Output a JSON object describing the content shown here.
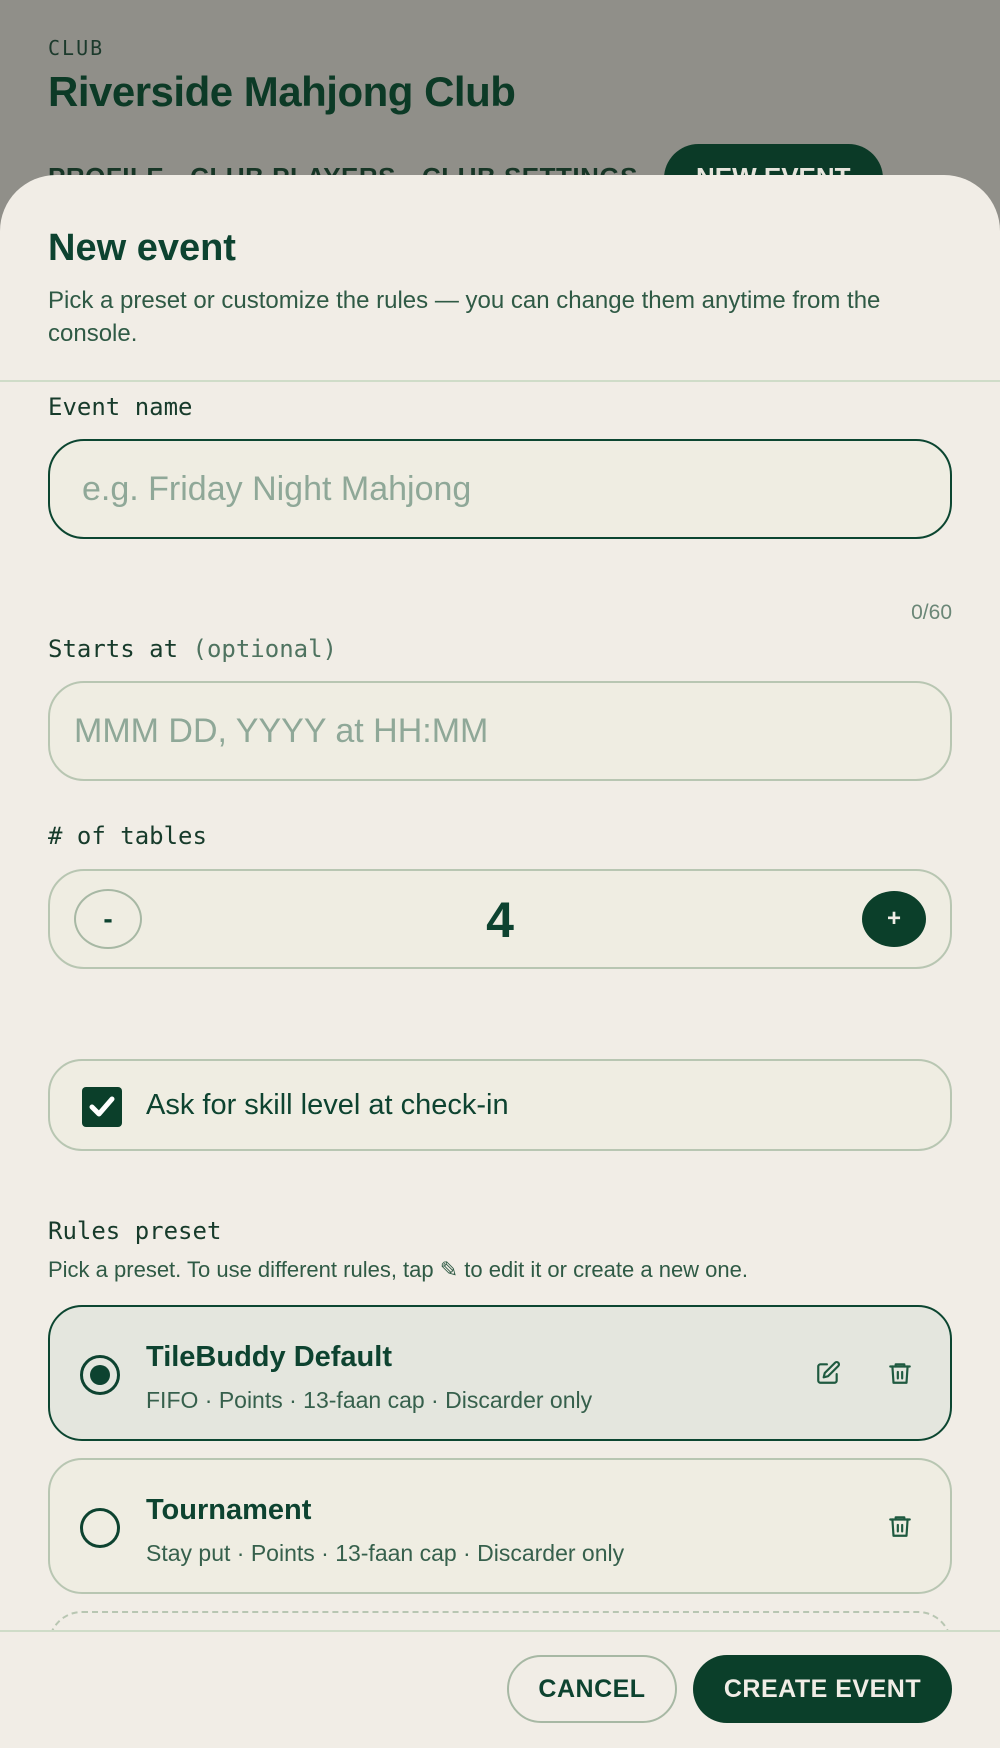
{
  "background": {
    "eyebrow": "CLUB",
    "club_name": "Riverside Mahjong Club",
    "tabs": [
      {
        "label": "PROFILE"
      },
      {
        "label": "CLUB PLAYERS"
      },
      {
        "label": "CLUB SETTINGS"
      },
      {
        "label": "NEW EVENT",
        "active": true
      }
    ]
  },
  "sheet": {
    "title": "New event",
    "subtitle": "Pick a preset or customize the rules — you can change them anytime from the console."
  },
  "event_name": {
    "label": "Event name",
    "placeholder": "e.g. Friday Night Mahjong",
    "value": "",
    "counter": "0/60"
  },
  "starts_at": {
    "label": "Starts at",
    "optional": "(optional)",
    "placeholder": "MMM DD, YYYY at HH:MM",
    "value": ""
  },
  "tables": {
    "label": "# of tables",
    "minus": "-",
    "plus": "+",
    "value": "4"
  },
  "skill_check": {
    "label": "Ask for skill level at check-in",
    "checked": true
  },
  "rules": {
    "label": "Rules preset",
    "help": "Pick a preset. To use different rules, tap ✎ to edit it or create a new one.",
    "presets": [
      {
        "name": "TileBuddy Default",
        "desc": "FIFO · Points · 13-faan cap · Discarder only",
        "selected": true,
        "editable": true
      },
      {
        "name": "Tournament",
        "desc": "Stay put · Points · 13-faan cap · Discarder only",
        "selected": false,
        "editable": false
      }
    ]
  },
  "footer": {
    "cancel": "CANCEL",
    "create": "CREATE EVENT"
  },
  "colors": {
    "primary": "#0b3f2a",
    "sheet_bg": "#f1ede6",
    "overlay": "#908f89"
  }
}
